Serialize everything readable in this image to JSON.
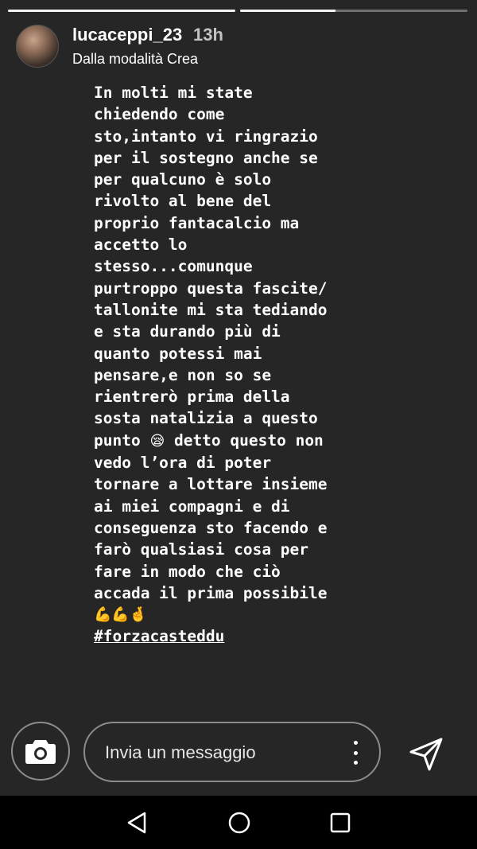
{
  "progress": {
    "segments": [
      1.0,
      0.42
    ]
  },
  "header": {
    "username": "lucaceppi_23",
    "time": "13h",
    "subtitle": "Dalla modalità Crea"
  },
  "story": {
    "lines": [
      "In molti mi state",
      "chiedendo come",
      "sto,intanto vi ringrazio",
      "per il sostegno anche se",
      "per qualcuno è solo",
      "rivolto al bene del",
      "proprio fantacalcio ma",
      "accetto lo",
      "stesso...comunque",
      "purtroppo questa fascite/",
      "tallonite mi sta tediando",
      "e sta durando più di",
      "quanto potessi mai",
      "pensare,e non so se",
      "rientrerò prima della",
      "sosta natalizia a questo"
    ],
    "line_punto_before": "punto ",
    "emoji_sad": "😪",
    "line_punto_after": " detto questo non",
    "lines2": [
      "vedo l’ora di poter",
      "tornare a lottare insieme",
      "ai miei compagni e di",
      "conseguenza sto facendo e",
      "farò qualsiasi cosa per",
      "fare in modo che ciò",
      "accada il prima possibile"
    ],
    "emoji_line": "💪💪🤞",
    "hashtag": "#forzacasteddu"
  },
  "footer": {
    "camera_icon": "camera-icon",
    "message_placeholder": "Invia un messaggio",
    "more_icon": "more-vertical-icon",
    "send_icon": "send-icon"
  },
  "nav": {
    "back_icon": "back-icon",
    "home_icon": "home-icon",
    "recent_icon": "recent-apps-icon"
  }
}
